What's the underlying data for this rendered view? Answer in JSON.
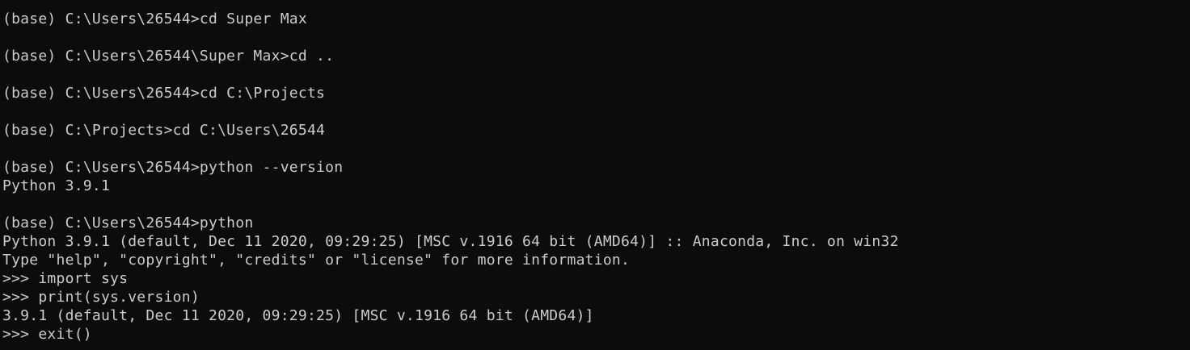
{
  "terminal": {
    "lines": [
      "(base) C:\\Users\\26544>cd Super Max",
      "",
      "(base) C:\\Users\\26544\\Super Max>cd ..",
      "",
      "(base) C:\\Users\\26544>cd C:\\Projects",
      "",
      "(base) C:\\Projects>cd C:\\Users\\26544",
      "",
      "(base) C:\\Users\\26544>python --version",
      "Python 3.9.1",
      "",
      "(base) C:\\Users\\26544>python",
      "Python 3.9.1 (default, Dec 11 2020, 09:29:25) [MSC v.1916 64 bit (AMD64)] :: Anaconda, Inc. on win32",
      "Type \"help\", \"copyright\", \"credits\" or \"license\" for more information.",
      ">>> import sys",
      ">>> print(sys.version)",
      "3.9.1 (default, Dec 11 2020, 09:29:25) [MSC v.1916 64 bit (AMD64)]",
      ">>> exit()"
    ]
  },
  "colors": {
    "background": "#0c0c0c",
    "foreground": "#cccccc"
  }
}
